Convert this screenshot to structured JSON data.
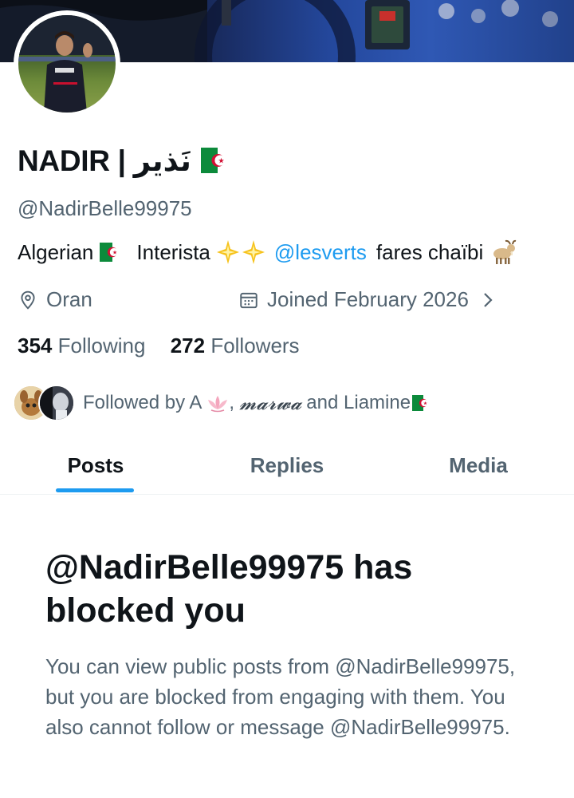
{
  "profile": {
    "display_name": "NADIR | نَذير",
    "handle": "@NadirBelle99975",
    "bio": {
      "part1": "Algerian",
      "part2": "Interista",
      "mention": "@lesverts",
      "part3": "fares chaïbi"
    },
    "location": "Oran",
    "joined": "Joined February 2026",
    "following_count": "354",
    "following_label": "Following",
    "followers_count": "272",
    "followers_label": "Followers",
    "followed_by": {
      "prefix": "Followed by A",
      "name2": "𝓶𝓪𝓻𝔀𝓪",
      "connector": "and Liamine"
    }
  },
  "tabs": [
    {
      "label": "Posts",
      "active": true
    },
    {
      "label": "Replies",
      "active": false
    },
    {
      "label": "Media",
      "active": false
    }
  ],
  "blocked": {
    "title": "@NadirBelle99975 has blocked you",
    "message": "You can view public posts from @NadirBelle99975, but you are blocked from engaging with them. You also cannot follow or message @NadirBelle99975."
  },
  "icons": {
    "flag": "algeria-flag-icon",
    "sparkles": "sparkles-icon",
    "goat": "goat-icon",
    "location": "location-pin-icon",
    "calendar": "calendar-icon",
    "chevron": "chevron-right-icon",
    "lotus": "lotus-icon"
  },
  "colors": {
    "accent": "#1d9bf0",
    "text_primary": "#0f1419",
    "text_secondary": "#536471",
    "flag_green": "#0c8a3b",
    "flag_red": "#d21034"
  }
}
